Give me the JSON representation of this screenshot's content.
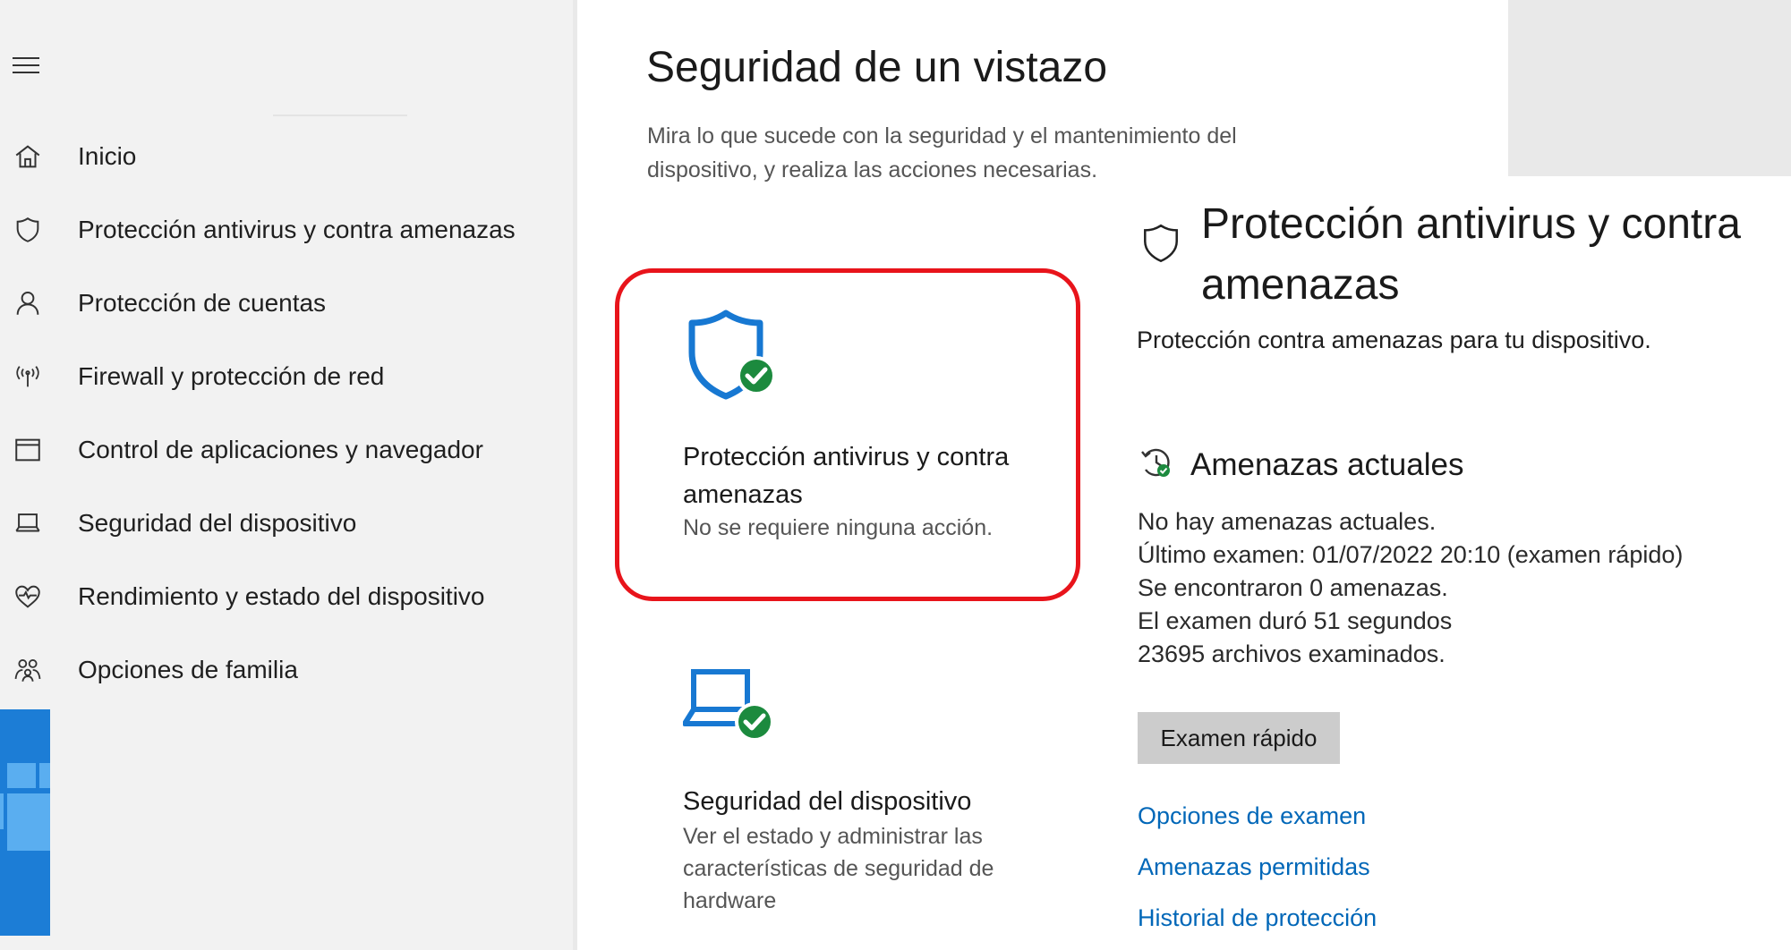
{
  "nav": {
    "items": [
      {
        "label": "Inicio",
        "icon": "home-icon"
      },
      {
        "label": "Protección antivirus y contra amenazas",
        "icon": "shield-icon"
      },
      {
        "label": "Protección de cuentas",
        "icon": "person-icon"
      },
      {
        "label": "Firewall y protección de red",
        "icon": "wifi-icon"
      },
      {
        "label": "Control de aplicaciones y navegador",
        "icon": "app-window-icon"
      },
      {
        "label": "Seguridad del dispositivo",
        "icon": "laptop-icon"
      },
      {
        "label": "Rendimiento y estado del dispositivo",
        "icon": "heart-icon"
      },
      {
        "label": "Opciones de familia",
        "icon": "family-icon"
      }
    ]
  },
  "main": {
    "title": "Seguridad de un vistazo",
    "subtitle_line1": "Mira lo que sucede con la seguridad y el mantenimiento del",
    "subtitle_line2": "dispositivo, y realiza las acciones necesarias.",
    "cards": [
      {
        "title_line1": "Protección antivirus y contra",
        "title_line2": "amenazas",
        "status": "No se requiere ninguna acción.",
        "icon": "shield-check-icon"
      },
      {
        "title": "Seguridad del dispositivo",
        "desc_line1": "Ver el estado y administrar las",
        "desc_line2": "características de seguridad de",
        "desc_line3": "hardware",
        "icon": "laptop-check-icon"
      }
    ]
  },
  "detail": {
    "title_line1": "Protección antivirus y contra",
    "title_line2": "amenazas",
    "subtitle": "Protección contra amenazas para tu dispositivo.",
    "section_title": "Amenazas actuales",
    "lines": [
      "No hay amenazas actuales.",
      "Último examen: 01/07/2022 20:10 (examen rápido)",
      "Se encontraron 0 amenazas.",
      "El examen duró 51 segundos",
      "23695 archivos examinados."
    ],
    "quick_scan_label": "Examen rápido",
    "links": [
      "Opciones de examen",
      "Amenazas permitidas",
      "Historial de protección"
    ]
  },
  "colors": {
    "accent_blue": "#0067b8",
    "icon_blue": "#1778d2",
    "check_green": "#1c8a3e",
    "highlight_red": "#e8141b"
  }
}
